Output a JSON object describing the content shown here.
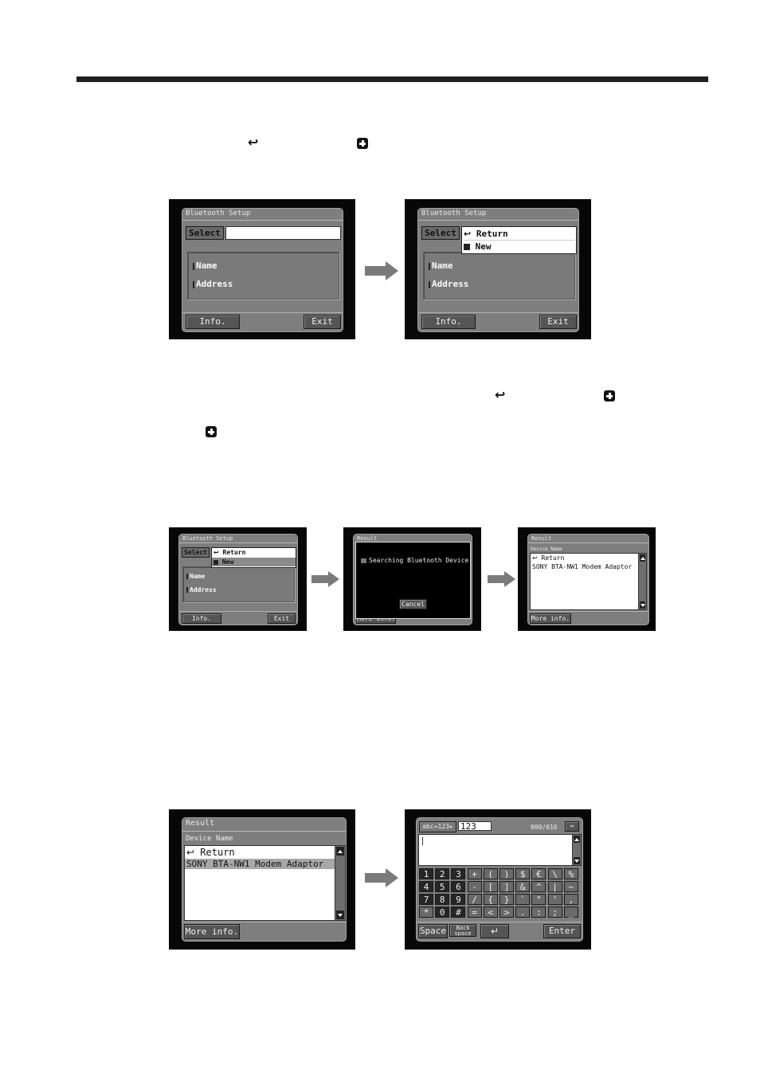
{
  "document": {
    "header_rule": "section-divider",
    "inline_icons": {
      "return_symbol": "↩",
      "new_symbol": "+"
    }
  },
  "figure1": {
    "before": {
      "title": "Bluetooth Setup",
      "select_label": "Select",
      "fields": [
        "Name",
        "Address"
      ],
      "info_button": "Info.",
      "exit_button": "Exit"
    },
    "after": {
      "title": "Bluetooth Setup",
      "select_label": "Select",
      "dropdown": [
        {
          "icon": "return-icon",
          "glyph": "↩",
          "label": "Return"
        },
        {
          "icon": "plus-box-icon",
          "glyph": "+",
          "label": "New"
        }
      ],
      "fields": [
        "Name",
        "Address"
      ],
      "info_button": "Info.",
      "exit_button": "Exit"
    }
  },
  "figure2": {
    "setup": {
      "title": "Bluetooth Setup",
      "select_label": "Select",
      "dropdown": [
        {
          "icon": "return-icon",
          "glyph": "↩",
          "label": "Return"
        },
        {
          "icon": "plus-box-icon",
          "glyph": "+",
          "label": "New",
          "highlighted": true
        }
      ],
      "fields": [
        "Name",
        "Address"
      ],
      "info_button": "Info.",
      "exit_button": "Exit"
    },
    "searching": {
      "title": "Result",
      "message": "Searching Bluetooth Device",
      "cancel_button": "Cancel",
      "behind_button": "More info."
    },
    "result": {
      "title": "Result",
      "list_header": "Device Name",
      "rows": [
        "Return",
        "SONY BTA-NW1 Modem Adaptor"
      ],
      "more_button": "More info."
    }
  },
  "figure3": {
    "result": {
      "title": "Result",
      "list_header": "Device Name",
      "rows": [
        "Return",
        "SONY BTA-NW1 Modem Adaptor"
      ],
      "selected_row": 1,
      "more_button": "More info."
    },
    "keyboard": {
      "mode_button": "abc↔123▸",
      "mode_value": "123",
      "counter": "000/016",
      "text_value": "",
      "keys": [
        [
          "1",
          "2",
          "3",
          "+",
          "(",
          ")",
          "$",
          "€",
          "\\",
          "%"
        ],
        [
          "4",
          "5",
          "6",
          "-",
          "[",
          "]",
          "&",
          "^",
          "|",
          "~"
        ],
        [
          "7",
          "8",
          "9",
          "/",
          "{",
          "}",
          "`",
          "\"",
          "'",
          ","
        ],
        [
          "*",
          "0",
          "#",
          "=",
          "<",
          ">",
          ".",
          ":",
          ";",
          "_"
        ]
      ],
      "space_button": "Space",
      "backspace_button": "Back space",
      "enter_symbol": "↵",
      "enter_button": "Enter"
    }
  }
}
